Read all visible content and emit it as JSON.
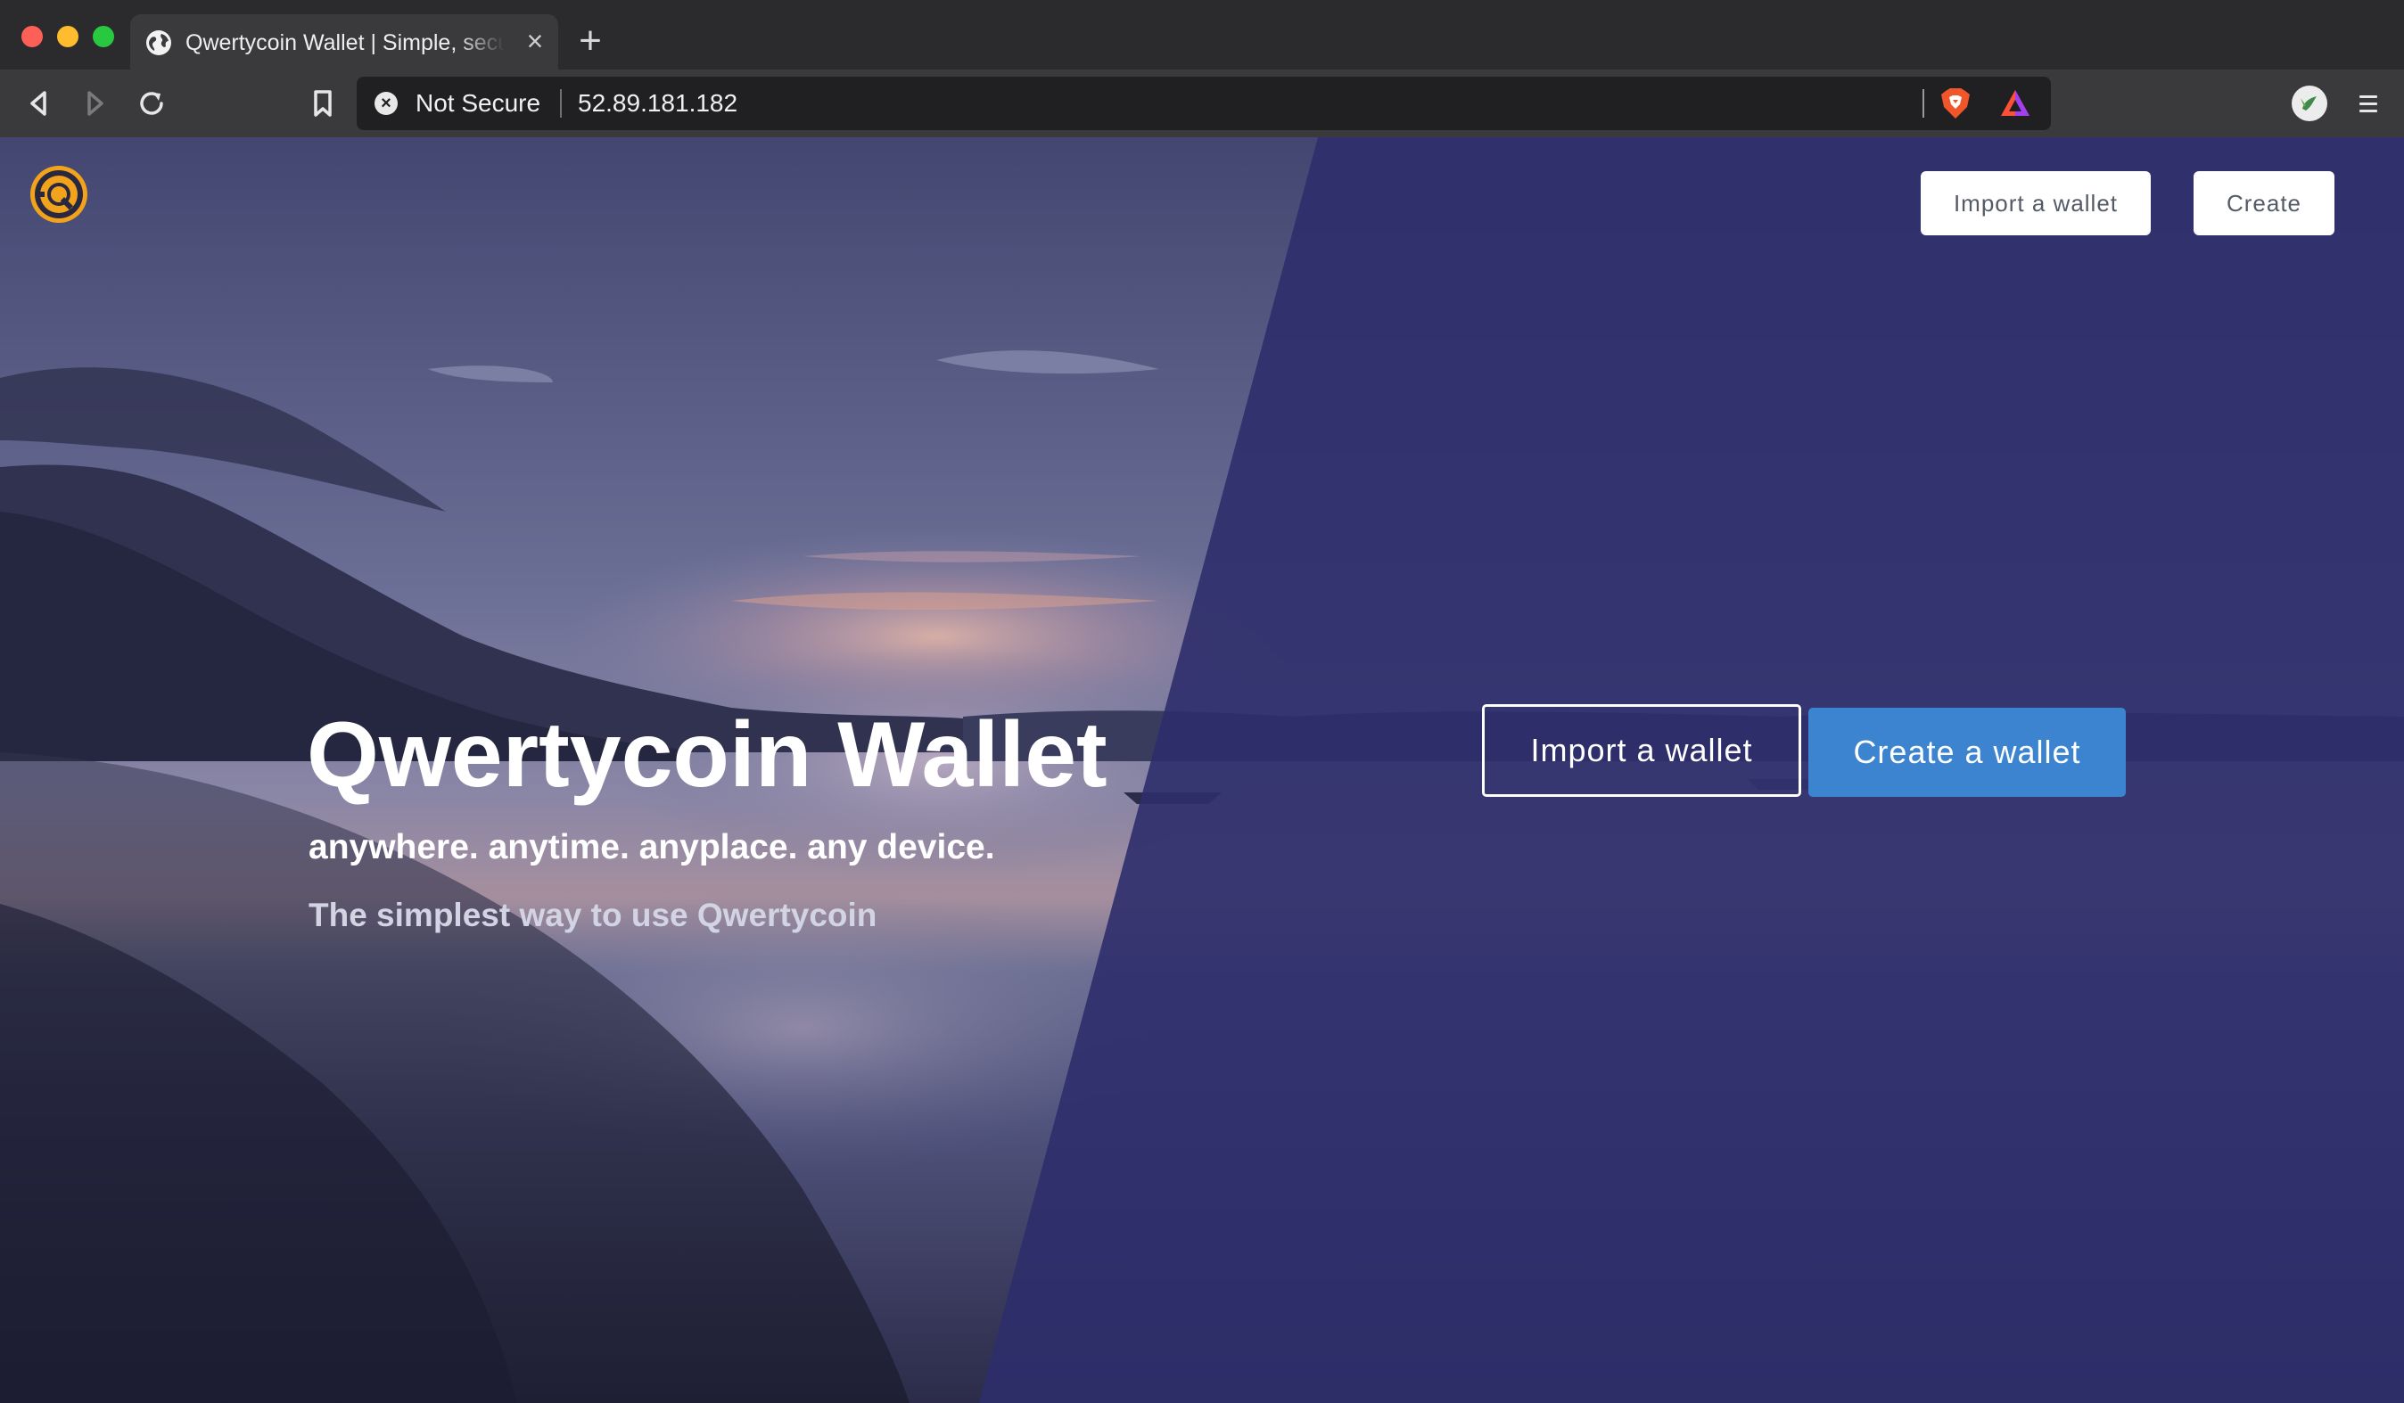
{
  "browser": {
    "tab": {
      "title": "Qwertycoin Wallet | Simple, secure",
      "close_glyph": "×"
    },
    "new_tab_glyph": "+",
    "address_bar": {
      "security_status": "Not Secure",
      "host": "52.89.181.182",
      "warning_glyph": "×"
    }
  },
  "page": {
    "nav": {
      "import_label": "Import a wallet",
      "create_label": "Create"
    },
    "hero": {
      "title": "Qwertycoin Wallet",
      "tagline": "anywhere. anytime. anyplace. any device.",
      "subtitle": "The simplest way to use Qwertycoin"
    },
    "actions": {
      "import_label": "Import a wallet",
      "create_label": "Create a wallet"
    }
  },
  "colors": {
    "overlay": "#2d2d6c",
    "primary_button": "#3c84d0",
    "logo_gold": "#f2a31c"
  },
  "icons": [
    "globe-icon",
    "back-icon",
    "forward-icon",
    "reload-icon",
    "bookmark-icon",
    "brave-shields-icon",
    "brave-rewards-icon",
    "profile-icon",
    "menu-icon",
    "qwertycoin-logo-icon"
  ]
}
